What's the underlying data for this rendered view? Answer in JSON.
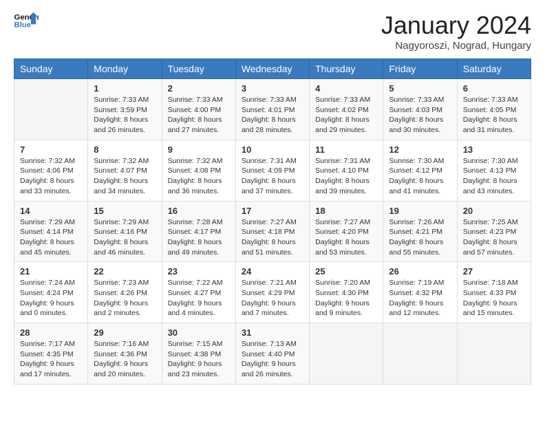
{
  "header": {
    "logo_line1": "General",
    "logo_line2": "Blue",
    "month": "January 2024",
    "location": "Nagyoroszi, Nograd, Hungary"
  },
  "weekdays": [
    "Sunday",
    "Monday",
    "Tuesday",
    "Wednesday",
    "Thursday",
    "Friday",
    "Saturday"
  ],
  "weeks": [
    [
      {
        "day": "",
        "sunrise": "",
        "sunset": "",
        "daylight": ""
      },
      {
        "day": "1",
        "sunrise": "Sunrise: 7:33 AM",
        "sunset": "Sunset: 3:59 PM",
        "daylight": "Daylight: 8 hours and 26 minutes."
      },
      {
        "day": "2",
        "sunrise": "Sunrise: 7:33 AM",
        "sunset": "Sunset: 4:00 PM",
        "daylight": "Daylight: 8 hours and 27 minutes."
      },
      {
        "day": "3",
        "sunrise": "Sunrise: 7:33 AM",
        "sunset": "Sunset: 4:01 PM",
        "daylight": "Daylight: 8 hours and 28 minutes."
      },
      {
        "day": "4",
        "sunrise": "Sunrise: 7:33 AM",
        "sunset": "Sunset: 4:02 PM",
        "daylight": "Daylight: 8 hours and 29 minutes."
      },
      {
        "day": "5",
        "sunrise": "Sunrise: 7:33 AM",
        "sunset": "Sunset: 4:03 PM",
        "daylight": "Daylight: 8 hours and 30 minutes."
      },
      {
        "day": "6",
        "sunrise": "Sunrise: 7:33 AM",
        "sunset": "Sunset: 4:05 PM",
        "daylight": "Daylight: 8 hours and 31 minutes."
      }
    ],
    [
      {
        "day": "7",
        "sunrise": "Sunrise: 7:32 AM",
        "sunset": "Sunset: 4:06 PM",
        "daylight": "Daylight: 8 hours and 33 minutes."
      },
      {
        "day": "8",
        "sunrise": "Sunrise: 7:32 AM",
        "sunset": "Sunset: 4:07 PM",
        "daylight": "Daylight: 8 hours and 34 minutes."
      },
      {
        "day": "9",
        "sunrise": "Sunrise: 7:32 AM",
        "sunset": "Sunset: 4:08 PM",
        "daylight": "Daylight: 8 hours and 36 minutes."
      },
      {
        "day": "10",
        "sunrise": "Sunrise: 7:31 AM",
        "sunset": "Sunset: 4:09 PM",
        "daylight": "Daylight: 8 hours and 37 minutes."
      },
      {
        "day": "11",
        "sunrise": "Sunrise: 7:31 AM",
        "sunset": "Sunset: 4:10 PM",
        "daylight": "Daylight: 8 hours and 39 minutes."
      },
      {
        "day": "12",
        "sunrise": "Sunrise: 7:30 AM",
        "sunset": "Sunset: 4:12 PM",
        "daylight": "Daylight: 8 hours and 41 minutes."
      },
      {
        "day": "13",
        "sunrise": "Sunrise: 7:30 AM",
        "sunset": "Sunset: 4:13 PM",
        "daylight": "Daylight: 8 hours and 43 minutes."
      }
    ],
    [
      {
        "day": "14",
        "sunrise": "Sunrise: 7:29 AM",
        "sunset": "Sunset: 4:14 PM",
        "daylight": "Daylight: 8 hours and 45 minutes."
      },
      {
        "day": "15",
        "sunrise": "Sunrise: 7:29 AM",
        "sunset": "Sunset: 4:16 PM",
        "daylight": "Daylight: 8 hours and 46 minutes."
      },
      {
        "day": "16",
        "sunrise": "Sunrise: 7:28 AM",
        "sunset": "Sunset: 4:17 PM",
        "daylight": "Daylight: 8 hours and 49 minutes."
      },
      {
        "day": "17",
        "sunrise": "Sunrise: 7:27 AM",
        "sunset": "Sunset: 4:18 PM",
        "daylight": "Daylight: 8 hours and 51 minutes."
      },
      {
        "day": "18",
        "sunrise": "Sunrise: 7:27 AM",
        "sunset": "Sunset: 4:20 PM",
        "daylight": "Daylight: 8 hours and 53 minutes."
      },
      {
        "day": "19",
        "sunrise": "Sunrise: 7:26 AM",
        "sunset": "Sunset: 4:21 PM",
        "daylight": "Daylight: 8 hours and 55 minutes."
      },
      {
        "day": "20",
        "sunrise": "Sunrise: 7:25 AM",
        "sunset": "Sunset: 4:23 PM",
        "daylight": "Daylight: 8 hours and 57 minutes."
      }
    ],
    [
      {
        "day": "21",
        "sunrise": "Sunrise: 7:24 AM",
        "sunset": "Sunset: 4:24 PM",
        "daylight": "Daylight: 9 hours and 0 minutes."
      },
      {
        "day": "22",
        "sunrise": "Sunrise: 7:23 AM",
        "sunset": "Sunset: 4:26 PM",
        "daylight": "Daylight: 9 hours and 2 minutes."
      },
      {
        "day": "23",
        "sunrise": "Sunrise: 7:22 AM",
        "sunset": "Sunset: 4:27 PM",
        "daylight": "Daylight: 9 hours and 4 minutes."
      },
      {
        "day": "24",
        "sunrise": "Sunrise: 7:21 AM",
        "sunset": "Sunset: 4:29 PM",
        "daylight": "Daylight: 9 hours and 7 minutes."
      },
      {
        "day": "25",
        "sunrise": "Sunrise: 7:20 AM",
        "sunset": "Sunset: 4:30 PM",
        "daylight": "Daylight: 9 hours and 9 minutes."
      },
      {
        "day": "26",
        "sunrise": "Sunrise: 7:19 AM",
        "sunset": "Sunset: 4:32 PM",
        "daylight": "Daylight: 9 hours and 12 minutes."
      },
      {
        "day": "27",
        "sunrise": "Sunrise: 7:18 AM",
        "sunset": "Sunset: 4:33 PM",
        "daylight": "Daylight: 9 hours and 15 minutes."
      }
    ],
    [
      {
        "day": "28",
        "sunrise": "Sunrise: 7:17 AM",
        "sunset": "Sunset: 4:35 PM",
        "daylight": "Daylight: 9 hours and 17 minutes."
      },
      {
        "day": "29",
        "sunrise": "Sunrise: 7:16 AM",
        "sunset": "Sunset: 4:36 PM",
        "daylight": "Daylight: 9 hours and 20 minutes."
      },
      {
        "day": "30",
        "sunrise": "Sunrise: 7:15 AM",
        "sunset": "Sunset: 4:38 PM",
        "daylight": "Daylight: 9 hours and 23 minutes."
      },
      {
        "day": "31",
        "sunrise": "Sunrise: 7:13 AM",
        "sunset": "Sunset: 4:40 PM",
        "daylight": "Daylight: 9 hours and 26 minutes."
      },
      {
        "day": "",
        "sunrise": "",
        "sunset": "",
        "daylight": ""
      },
      {
        "day": "",
        "sunrise": "",
        "sunset": "",
        "daylight": ""
      },
      {
        "day": "",
        "sunrise": "",
        "sunset": "",
        "daylight": ""
      }
    ]
  ]
}
